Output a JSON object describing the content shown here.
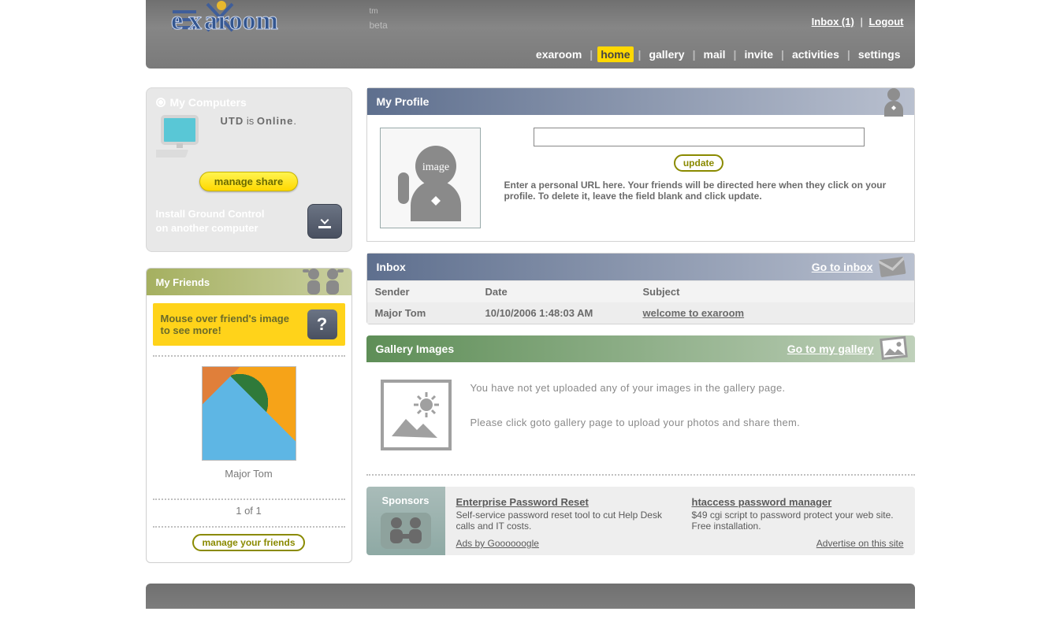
{
  "header": {
    "inbox_link": "Inbox (1)",
    "logout": "Logout",
    "logo_tm": "tm",
    "logo_beta": "beta"
  },
  "nav": {
    "items": [
      "exaroom",
      "home",
      "gallery",
      "mail",
      "invite",
      "activities",
      "settings"
    ],
    "active_index": 1
  },
  "sidebar": {
    "computers": {
      "title": "My Computers",
      "pc_name": "UTD",
      "is_word": "is",
      "status": "Online",
      "dot": ".",
      "manage_share": "manage share",
      "install_line1": "Install Ground Control",
      "install_line2": "on another computer"
    },
    "friends": {
      "title": "My Friends",
      "hint_line": "Mouse over friend's image to see more!",
      "name": "Major Tom",
      "pager": "1 of  1",
      "manage": "manage your friends"
    }
  },
  "profile": {
    "title": "My Profile",
    "update": "update",
    "help": "Enter a personal URL here. Your friends will be directed here when they click on your profile. To delete it, leave the field blank and click update.",
    "url_value": ""
  },
  "inbox": {
    "title": "Inbox",
    "goto": "Go to inbox",
    "cols": {
      "sender": "Sender",
      "date": "Date",
      "subject": "Subject"
    },
    "rows": [
      {
        "sender": "Major Tom",
        "date": "10/10/2006 1:48:03 AM",
        "subject": "welcome to exaroom"
      }
    ]
  },
  "gallery": {
    "title": "Gallery Images",
    "goto": "Go to my gallery",
    "text1": "You have not yet uploaded any of your images in the gallery page.",
    "text2": "Please click goto gallery page to upload your photos and share them."
  },
  "sponsors": {
    "side": "Sponsors",
    "ads": [
      {
        "title": "Enterprise Password Reset",
        "desc": "Self-service password reset tool to cut Help Desk calls and IT costs."
      },
      {
        "title": "htaccess password manager",
        "desc": "$49 cgi script to password protect your web site. Free installation."
      }
    ],
    "ads_by": "Ads by Goooooogle",
    "advertise": "Advertise on this site"
  }
}
